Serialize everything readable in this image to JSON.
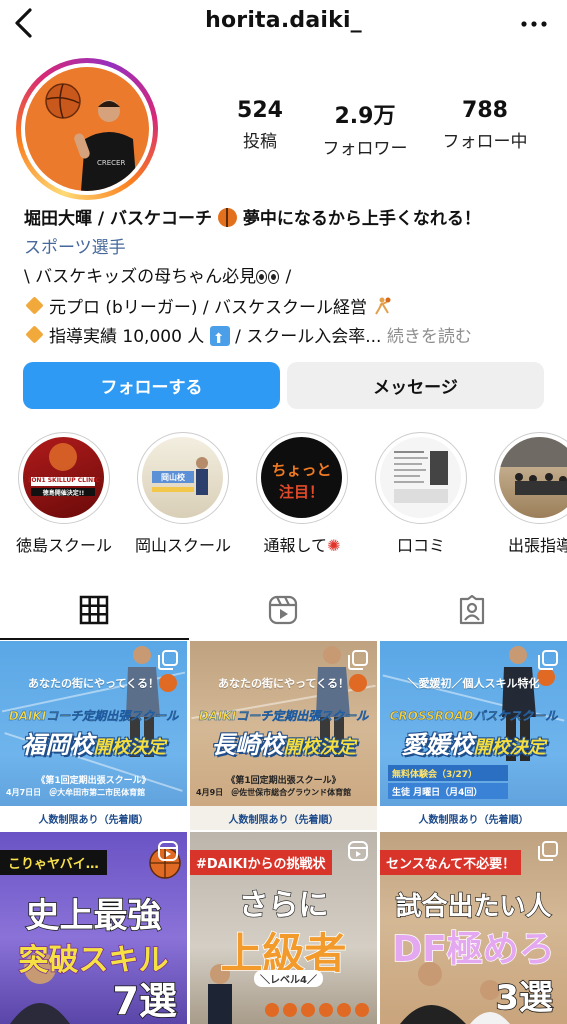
{
  "header": {
    "username": "horita.daiki_"
  },
  "profile": {
    "stats": [
      {
        "value": "524",
        "label": "投稿"
      },
      {
        "value": "2.9万",
        "label": "フォロワー"
      },
      {
        "value": "788",
        "label": "フォロー中"
      }
    ],
    "name_part1": "堀田大暉 / バスケコーチ",
    "name_part2": "夢中になるから上手くなれる！",
    "category": "スポーツ選手",
    "bio_line1_a": "\\ バスケキッズの母ちゃん必見",
    "bio_line1_b": " /",
    "bio_line2": "元プロ (bリーガー) / バスケスクール経営",
    "bio_line3_a": "指導実績 10,000 人",
    "bio_line3_b": " / スクール入会率...",
    "bio_more": " 続きを読む"
  },
  "buttons": {
    "follow": "フォローする",
    "message": "メッセージ"
  },
  "highlights": [
    {
      "label": "徳島スクール",
      "t1": "1ON1 SKILLUP CLINIC",
      "t2": "徳島開催決定!!"
    },
    {
      "label": "岡山スクール",
      "t1": "岡山校"
    },
    {
      "label": "通報して",
      "t1": "ちょっと",
      "t2": "注目！"
    },
    {
      "label": "口コミ"
    },
    {
      "label": "出張指導"
    }
  ],
  "posts": {
    "p1": {
      "tagline": "あなたの街にやってくる！",
      "sub": "DAIKIコーチ定期出張スクール",
      "big": "福岡校",
      "kai": "開校決定",
      "s1": "《第1回定期出張スクール》",
      "s2": "4月7日日　＠大牟田市第二市民体育館",
      "limit": "人数制限あり（先着順）"
    },
    "p2": {
      "tagline": "あなたの街にやってくる！",
      "sub": "DAIKIコーチ定期出張スクール",
      "big": "長崎校",
      "kai": "開校決定",
      "s1": "《第1回定期出張スクール》",
      "s2": "4月9日　＠佐世保市総合グラウンド体育館",
      "limit": "人数制限あり（先着順）"
    },
    "p3": {
      "tagline": "＼愛媛初／個人スキル特化",
      "sub": "CROSSROADバスケスクール",
      "big": "愛媛校",
      "kai": "開校決定",
      "trial1": "無料体験会（3/27）",
      "trial2": "生徒 月曜日（月4回）",
      "limit": "人数制限あり（先着順）"
    },
    "p4": {
      "label": "こりゃヤバイ…",
      "t1": "史上最強",
      "t2": "突破スキル",
      "t3": "7選"
    },
    "p5": {
      "label": "#DAIKIからの挑戦状",
      "t1": "さらに",
      "t2": "上級者",
      "lv": "＼レベル4／"
    },
    "p6": {
      "label": "センスなんて不必要！",
      "t1": "試合出たい人",
      "t2": "DF極めろ",
      "t3": "3選"
    }
  },
  "colors": {
    "accent": "#2f9af3",
    "category": "#46689b",
    "avatar_bg": "#ec7a2c"
  }
}
